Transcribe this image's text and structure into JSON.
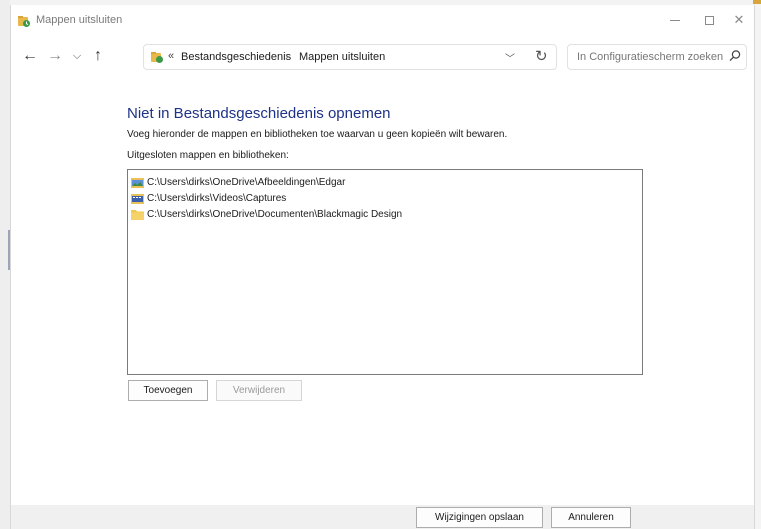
{
  "window": {
    "title": "Mappen uitsluiten"
  },
  "navigation": {
    "address_overflow": "«",
    "breadcrumbs": [
      "Bestandsgeschiedenis",
      "Mappen uitsluiten"
    ],
    "separator": "›",
    "search_placeholder": "In Configuratiescherm zoeken"
  },
  "content": {
    "heading": "Niet in Bestandsgeschiedenis opnemen",
    "description": "Voeg hieronder de mappen en bibliotheken toe waarvan u geen kopieën wilt bewaren.",
    "list_label": "Uitgesloten mappen en bibliotheken:",
    "excluded_items": [
      {
        "path": "C:\\Users\\dirks\\OneDrive\\Afbeeldingen\\Edgar",
        "icon": "pictures-folder-icon"
      },
      {
        "path": "C:\\Users\\dirks\\Videos\\Captures",
        "icon": "videos-folder-icon"
      },
      {
        "path": "C:\\Users\\dirks\\OneDrive\\Documenten\\Blackmagic Design",
        "icon": "folder-icon"
      }
    ],
    "add_button": "Toevoegen",
    "remove_button": "Verwijderen"
  },
  "footer": {
    "save_button": "Wijzigingen opslaan",
    "cancel_button": "Annuleren"
  },
  "colors": {
    "heading": "#1e3287",
    "footer_bg": "#f0f0f0"
  }
}
